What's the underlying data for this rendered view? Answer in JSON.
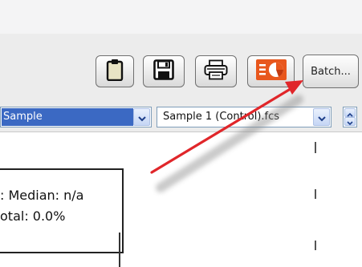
{
  "toolbar": {
    "buttons": [
      {
        "name": "clipboard-button",
        "icon": "clipboard-icon"
      },
      {
        "name": "save-button",
        "icon": "floppy-disk-icon"
      },
      {
        "name": "print-button",
        "icon": "printer-icon"
      },
      {
        "name": "export-powerpoint-button",
        "icon": "powerpoint-icon"
      }
    ],
    "batch_label": "Batch..."
  },
  "selectors": {
    "type_value": "Sample",
    "file_value": "Sample 1 (Control).fcs"
  },
  "stats_panel": {
    "median_text": ": Median: n/a",
    "total_text": "otal: 0.0%"
  },
  "colors": {
    "selection": "#3b69c3",
    "annotation_arrow": "#e0262a",
    "powerpoint_orange": "#e8571d"
  }
}
